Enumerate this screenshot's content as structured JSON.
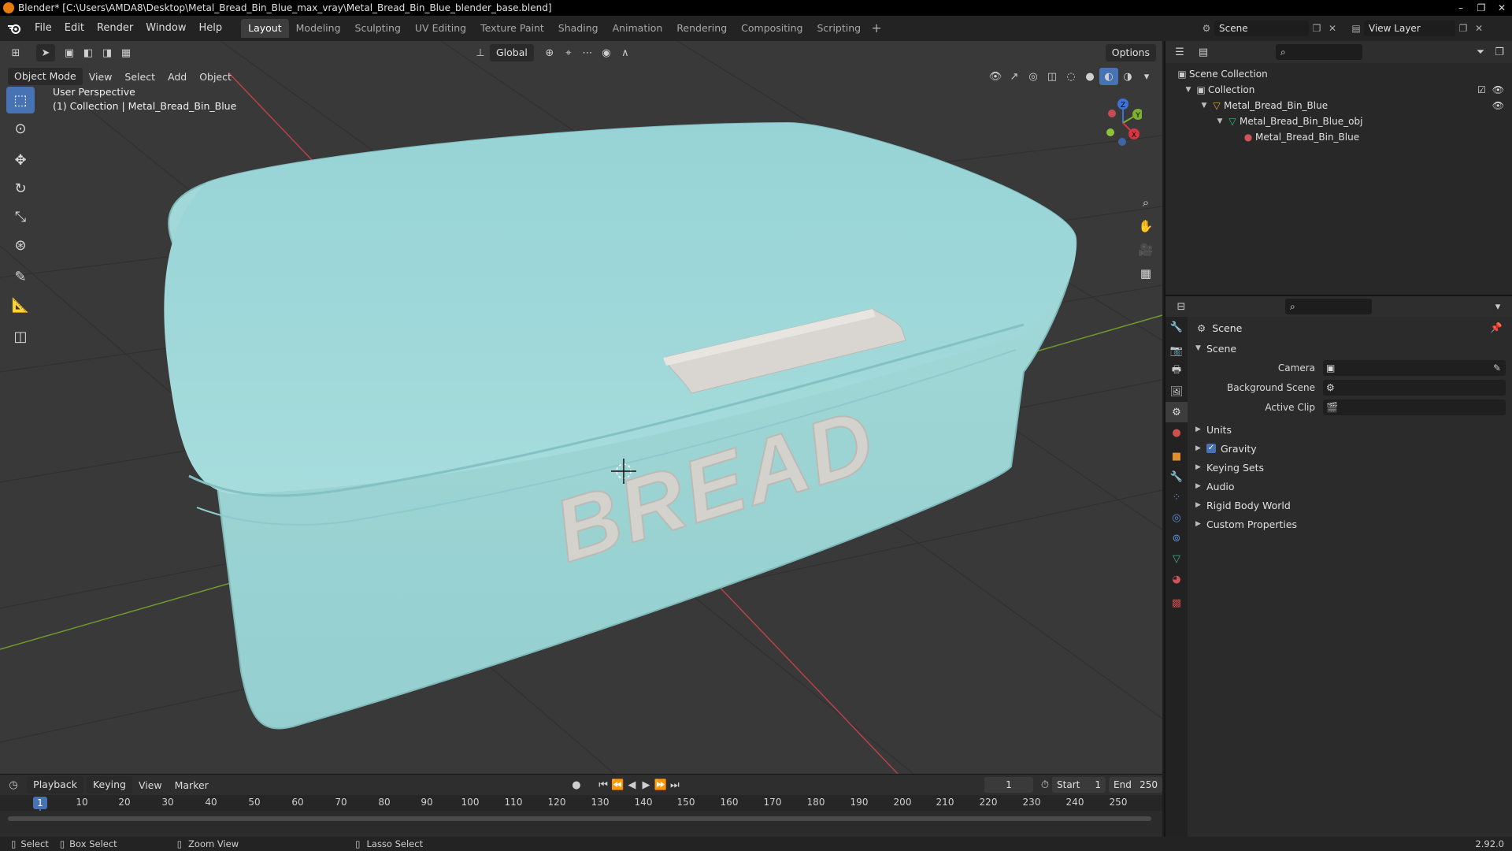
{
  "window": {
    "title": "Blender* [C:\\Users\\AMDA8\\Desktop\\Metal_Bread_Bin_Blue_max_vray\\Metal_Bread_Bin_Blue_blender_base.blend]",
    "controls": [
      "–",
      "❐",
      "✕"
    ]
  },
  "topbar": {
    "menus": [
      "File",
      "Edit",
      "Render",
      "Window",
      "Help"
    ],
    "workspaces": [
      "Layout",
      "Modeling",
      "Sculpting",
      "UV Editing",
      "Texture Paint",
      "Shading",
      "Animation",
      "Rendering",
      "Compositing",
      "Scripting"
    ],
    "active_workspace": "Layout",
    "scene": "Scene",
    "view_layer": "View Layer"
  },
  "viewport": {
    "mode": "Object Mode",
    "menus": [
      "View",
      "Select",
      "Add",
      "Object"
    ],
    "transform_orientation": "Global",
    "options_label": "Options",
    "perspective": "User Perspective",
    "collection_info": "(1) Collection | Metal_Bread_Bin_Blue",
    "model_text": "BREAD",
    "colors": {
      "bin": "#9fd8d8",
      "bin_shadow": "#86c3c4",
      "handle": "#d9d6d2",
      "grid_bg": "#393939",
      "x_axis": "#b8424a",
      "y_axis": "#6f9a2e"
    },
    "gizmo_labels": {
      "z": "Z",
      "y": "Y",
      "x": "X"
    }
  },
  "timeline": {
    "menus": [
      "Playback",
      "Keying",
      "View",
      "Marker"
    ],
    "current_frame": "1",
    "start_label": "Start",
    "start": "1",
    "end_label": "End",
    "end": "250",
    "ticks": [
      "1",
      "10",
      "20",
      "30",
      "40",
      "50",
      "60",
      "70",
      "80",
      "90",
      "100",
      "110",
      "120",
      "130",
      "140",
      "150",
      "160",
      "170",
      "180",
      "190",
      "200",
      "210",
      "220",
      "230",
      "240",
      "250"
    ]
  },
  "statusbar": {
    "items": [
      "Select",
      "Box Select",
      "Zoom View",
      "Lasso Select"
    ],
    "version": "2.92.0"
  },
  "outliner": {
    "rows": [
      {
        "label": "Scene Collection"
      },
      {
        "label": "Collection"
      },
      {
        "label": "Metal_Bread_Bin_Blue"
      },
      {
        "label": "Metal_Bread_Bin_Blue_obj"
      },
      {
        "label": "Metal_Bread_Bin_Blue"
      }
    ]
  },
  "properties": {
    "context": "Scene",
    "panel_title": "Scene",
    "fields": [
      {
        "label": "Camera"
      },
      {
        "label": "Background Scene"
      },
      {
        "label": "Active Clip"
      }
    ],
    "subpanels": [
      "Units",
      "Gravity",
      "Keying Sets",
      "Audio",
      "Rigid Body World",
      "Custom Properties"
    ]
  }
}
